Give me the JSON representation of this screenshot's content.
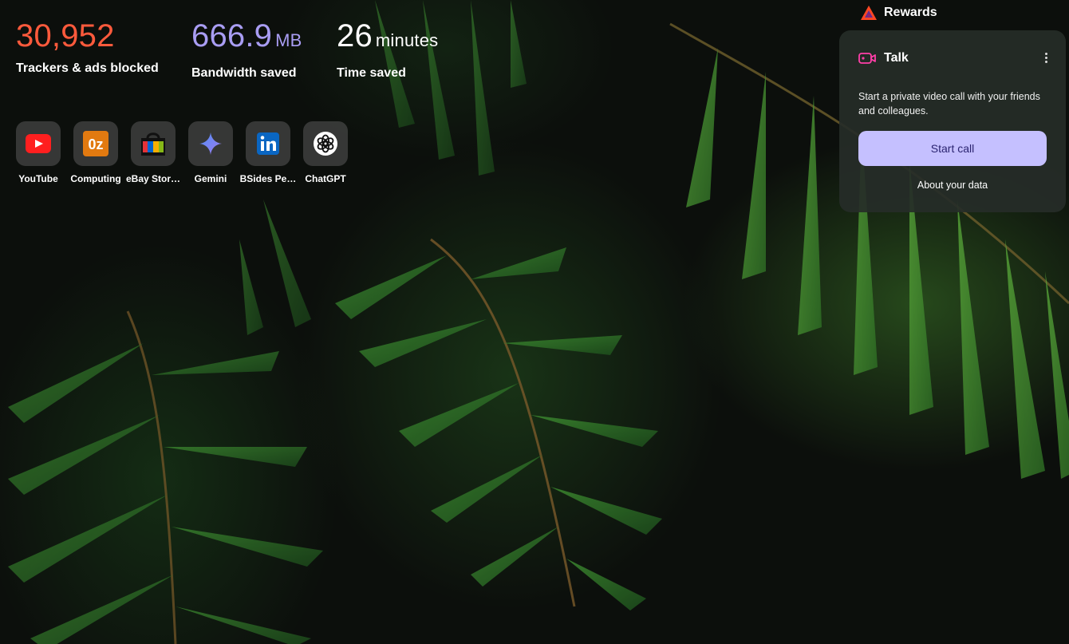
{
  "stats": {
    "trackers": {
      "value": "30,952",
      "label": "Trackers & ads blocked"
    },
    "bandwidth": {
      "value": "666.9",
      "unit": "MB",
      "label": "Bandwidth saved"
    },
    "time": {
      "value": "26",
      "unit": "minutes",
      "label": "Time saved"
    }
  },
  "colors": {
    "trackers": "#ff5a3c",
    "bandwidth": "#a99df3",
    "accent_button": "#c5c0ff"
  },
  "top_sites": [
    {
      "label": "YouTube",
      "icon": "youtube-icon"
    },
    {
      "label": "Computing",
      "icon": "oz-icon"
    },
    {
      "label": "eBay Stor…",
      "icon": "ebay-store-icon"
    },
    {
      "label": "Gemini",
      "icon": "gemini-icon"
    },
    {
      "label": "BSides Pe…",
      "icon": "linkedin-icon"
    },
    {
      "label": "ChatGPT",
      "icon": "chatgpt-icon"
    }
  ],
  "rewards": {
    "label": "Rewards",
    "icon": "bat-triangle-icon"
  },
  "talk": {
    "title": "Talk",
    "icon": "video-camera-icon",
    "description": "Start a private video call with your friends and colleagues.",
    "button_label": "Start call",
    "link_label": "About your data",
    "menu_icon": "more-vertical-icon"
  }
}
